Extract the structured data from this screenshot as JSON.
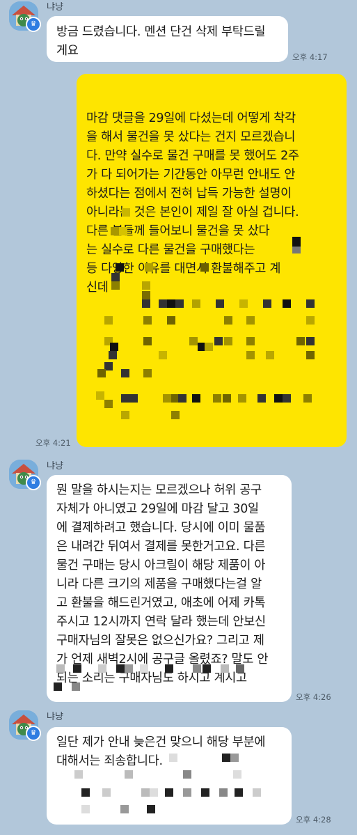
{
  "sender": {
    "name": "냐냥"
  },
  "messages": [
    {
      "lines": [
        "방금 드렸습니다. 멘션 단건 삭제 부탁드릴",
        "게요"
      ],
      "time": "오후 4:17"
    },
    {
      "lines": [
        "마감 댓글을 29일에 다셨는데 어떻게 착각",
        "을 해서 물건을 못 샀다는 건지 모르겠습니",
        "다. 만약 실수로 물건 구매를 못 했어도 2주",
        "가 다 되어가는 기간동안 아무런 안내도 안",
        "하셨다는 점에서 전혀 납득 가능한 설명이",
        "아니라는 것은 본인이 제일 잘 아실 겁니다.",
        "다른      분들께 들어보니 물건을 못 샀다",
        "는         실수로 다른 물건을 구매했다는",
        "등 다양한 이유를 대면서 환불해주고 계",
        "신데"
      ],
      "time": "오후 4:21"
    },
    {
      "lines": [
        "뭔 말을 하시는지는 모르겠으나 허위 공구",
        "자체가 아니였고 29일에 마감 달고 30일",
        "에 결제하려고 했습니다. 당시에 이미 물품",
        "은 내려간 뒤여서 결제를 못한거고요. 다른",
        "물건 구매는 당시 아크릴이 해당 제품이 아",
        "니라 다른 크기의 제품을 구매했다는걸 알",
        "고 환불을 해드린거였고, 애초에 어제 카톡",
        "주시고 12시까지 연락 달라 했는데 안보신",
        "구매자님의 잘못은 없으신가요? 그리고 제",
        "가 언제 새벽2시에 공구글 올렸죠? 말도 안",
        "되는 소리는 구매자님도 하시고 계시고"
      ],
      "time": "오후 4:26"
    },
    {
      "lines": [
        "일단 제가 안내 늦은건 맞으니 해당 부분에",
        "대해서는 죄송합니다."
      ],
      "time": "오후 4:28"
    }
  ]
}
